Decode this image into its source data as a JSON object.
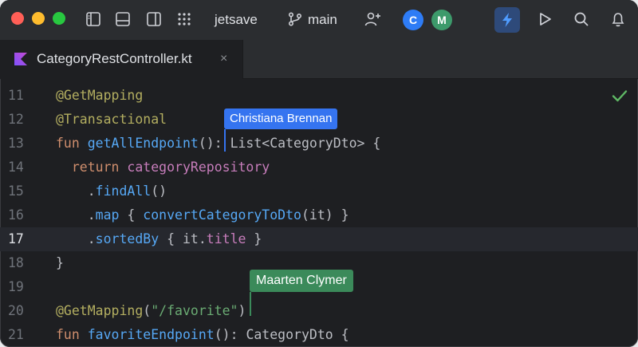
{
  "window": {
    "project_name": "jetsave",
    "branch": "main",
    "avatars": [
      {
        "initial": "C",
        "color": "#2e7cf6"
      },
      {
        "initial": "M",
        "color": "#3d9a6b"
      }
    ],
    "icons": [
      "sidebar-left-icon",
      "panel-bottom-icon",
      "sidebar-right-icon",
      "grid-icon",
      "branch-icon",
      "add-user-icon",
      "ai-bolt-icon",
      "run-icon",
      "search-icon",
      "bell-icon"
    ]
  },
  "tab": {
    "title": "CategoryRestController.kt",
    "close_glyph": "×"
  },
  "editor": {
    "current_line": "17",
    "lines": [
      {
        "number": "11",
        "text": "@GetMapping"
      },
      {
        "number": "12",
        "text": "@Transactional"
      },
      {
        "number": "13",
        "text": "fun getAllEndpoint(): List<CategoryDto> {"
      },
      {
        "number": "14",
        "text": "  return categoryRepository"
      },
      {
        "number": "15",
        "text": "    .findAll()"
      },
      {
        "number": "16",
        "text": "    .map { convertCategoryToDto(it) }"
      },
      {
        "number": "17",
        "text": "    .sortedBy { it.title }"
      },
      {
        "number": "18",
        "text": "}"
      },
      {
        "number": "19",
        "text": ""
      },
      {
        "number": "20",
        "text": "@GetMapping(\"/favorite\")"
      },
      {
        "number": "21",
        "text": "fun favoriteEndpoint(): CategoryDto {"
      }
    ]
  },
  "collaborators": [
    {
      "name": "Christiana Brennan",
      "color": "#3574f0"
    },
    {
      "name": "Maarten Clymer",
      "color": "#3b8a5a"
    }
  ],
  "status": {
    "inspection": "check-icon"
  }
}
